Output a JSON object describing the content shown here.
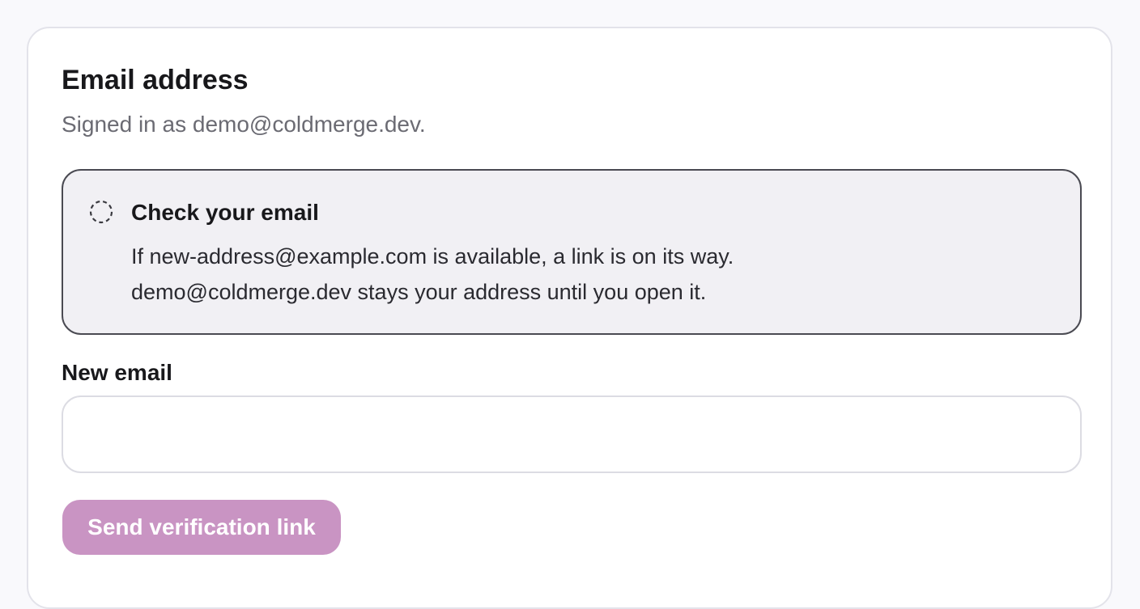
{
  "section": {
    "title": "Email address",
    "subtitle": "Signed in as demo@coldmerge.dev."
  },
  "notice": {
    "icon": "pending-dashed-circle-icon",
    "title": "Check your email",
    "line1": "If new-address@example.com is available, a link is on its way.",
    "line2": "demo@coldmerge.dev stays your address until you open it."
  },
  "form": {
    "label": "New email",
    "value": "",
    "placeholder": "",
    "button_label": "Send verification link"
  },
  "colors": {
    "accent_disabled": "#c994c3",
    "notice_bg": "#f1f0f4",
    "notice_border": "#4a4a52"
  }
}
